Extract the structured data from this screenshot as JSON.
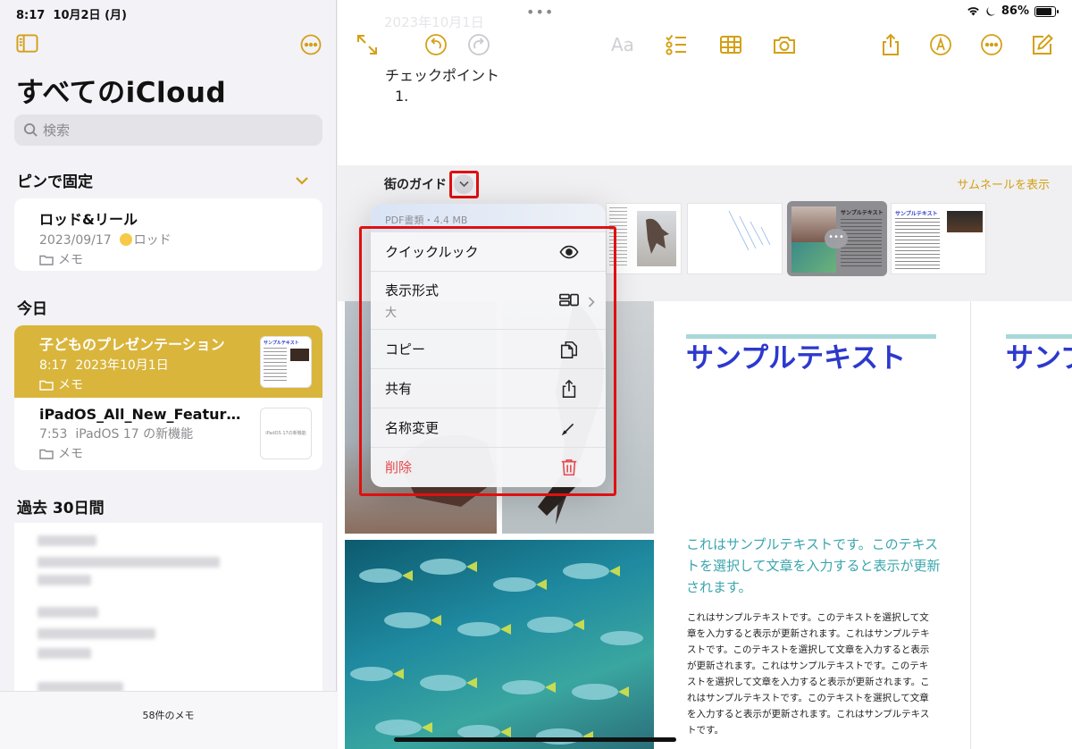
{
  "status": {
    "time": "8:17",
    "date": "10月2日 (月)",
    "battery": "86%"
  },
  "sidebar": {
    "title": "すべてのiCloud",
    "search_placeholder": "検索",
    "pinned_header": "ピンで固定",
    "pinned": [
      {
        "title": "ロッド&リール",
        "date": "2023/09/17",
        "tag": "ロッド",
        "folder": "メモ"
      }
    ],
    "today_header": "今日",
    "today": [
      {
        "title": "子どものプレゼンテーション",
        "time": "8:17",
        "date": "2023年10月1日",
        "folder": "メモ",
        "thumb_text": "サンプルテキスト"
      },
      {
        "title": "iPadOS_All_New_Features…",
        "time": "7:53",
        "subtitle": "iPadOS 17 の新機能",
        "folder": "メモ",
        "thumb_text": "iPadOS 17の新機能"
      }
    ],
    "past30_header": "過去 30日間",
    "footer": "58件のメモ"
  },
  "main": {
    "ghost_date": "2023年10月1日",
    "text_format_label": "Aa",
    "checkpoint": "チェックポイント",
    "list_item": "1.",
    "attachment": {
      "title": "街のガイド",
      "thumbnail_link": "サムネールを表示"
    },
    "doc": {
      "heading": "サンプルテキスト",
      "heading_partial": "サンプ",
      "lead": "これはサンプルテキストです。このテキストを選択して文章を入力すると表示が更新されます。",
      "body": "これはサンプルテキストです。このテキストを選択して文章を入力すると表示が更新されます。これはサンプルテキストです。このテキストを選択して文章を入力すると表示が更新されます。これはサンプルテキストです。このテキストを選択して文章を入力すると表示が更新されます。これはサンプルテキストです。このテキストを選択して文章を入力すると表示が更新されます。これはサンプルテキストです。"
    }
  },
  "menu": {
    "header": "PDF書類・4.4 MB",
    "items": [
      {
        "label": "クイックルック",
        "icon": "eye-icon"
      },
      {
        "label": "表示形式",
        "sublabel": "大",
        "icon": "layout-icon"
      },
      {
        "label": "コピー",
        "icon": "copy-icon"
      },
      {
        "label": "共有",
        "icon": "share-icon"
      },
      {
        "label": "名称変更",
        "icon": "pencil-icon"
      },
      {
        "label": "削除",
        "icon": "trash-icon"
      }
    ]
  },
  "colors": {
    "accent": "#d4a017",
    "selected": "#d9b53c",
    "highlight": "#e01010",
    "danger": "#e5484d",
    "doc_heading": "#2d39cc",
    "doc_lead": "#3aa5ad"
  }
}
